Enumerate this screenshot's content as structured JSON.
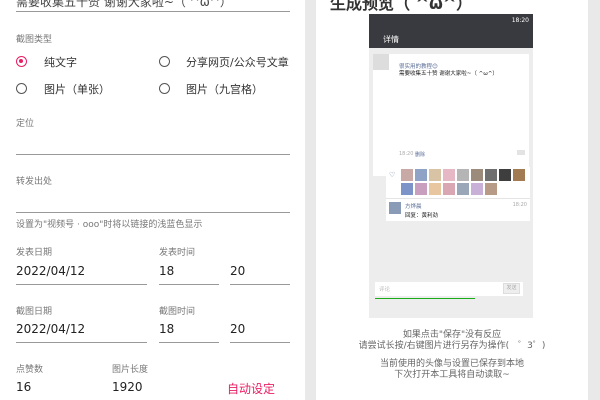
{
  "top_text": "需要收集五十赞 谢谢大家啦~（ ^ω^）",
  "type_section": {
    "label": "截图类型",
    "options": [
      {
        "label": "纯文字",
        "selected": true
      },
      {
        "label": "分享网页/公众号文章",
        "selected": false
      },
      {
        "label": "图片（单张）",
        "selected": false
      },
      {
        "label": "图片（九宫格）",
        "selected": false
      }
    ]
  },
  "location": {
    "label": "定位",
    "value": ""
  },
  "forward": {
    "label": "转发出处",
    "value": ""
  },
  "hint": "设置为\"视频号 · ooo\"时将以链接的浅蓝色显示",
  "publish": {
    "date_label": "发表日期",
    "date": "2022/04/12",
    "time_label": "发表时间",
    "hour": "18",
    "minute": "20"
  },
  "screenshot": {
    "date_label": "截图日期",
    "date": "2022/04/12",
    "time_label": "截图时间",
    "hour": "18",
    "minute": "20"
  },
  "likes": {
    "label": "点赞数",
    "value": "16"
  },
  "image_length": {
    "label": "图片长度",
    "value": "1920"
  },
  "auto_button": "自动设定",
  "preview": {
    "heading": "生成预览（ ^ω^）",
    "status_time": "18:20",
    "nav_title": "详情",
    "post_line1": "很实用的教程😊",
    "post_line2": "需要收集五十赞 谢谢大家啦~（ ^ω^）",
    "post_time": "18:20",
    "delete": "删除",
    "comment_name": "方烨晨",
    "comment_text": "回复：黄利劲",
    "comment_time": "18:20",
    "input_placeholder": "评论",
    "send": "发送"
  },
  "footer": {
    "line1": "如果点击\"保存\"没有反应",
    "line2": "请尝试长按/右键图片进行另存为操作(　゜3゜)",
    "line3": "当前使用的头像与设置已保存到本地",
    "line4": "下次打开本工具将自动读取~"
  },
  "colors": {
    "accent": "#e91e63",
    "link_blue": "#576b95",
    "nav_dark": "#393a3f"
  }
}
